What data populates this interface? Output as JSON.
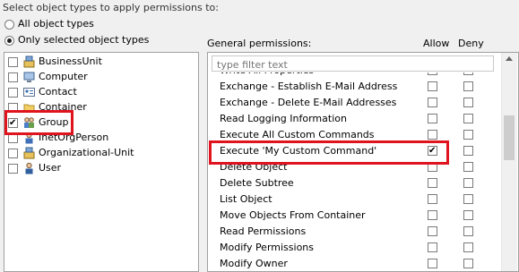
{
  "apply_label": "Select object types to apply permissions to:",
  "radio_all": {
    "label": "All object types",
    "selected": false
  },
  "radio_selected": {
    "label": "Only selected object types",
    "selected": true
  },
  "object_types": [
    {
      "label": "BusinessUnit",
      "icon": "org-unit-icon",
      "checked": false
    },
    {
      "label": "Computer",
      "icon": "computer-icon",
      "checked": false
    },
    {
      "label": "Contact",
      "icon": "contact-card-icon",
      "checked": false
    },
    {
      "label": "Container",
      "icon": "folder-icon",
      "checked": false
    },
    {
      "label": "Group",
      "icon": "group-icon",
      "checked": true
    },
    {
      "label": "InetOrgPerson",
      "icon": "person-icon",
      "checked": false
    },
    {
      "label": "Organizational-Unit",
      "icon": "org-unit-icon",
      "checked": false
    },
    {
      "label": "User",
      "icon": "user-icon",
      "checked": false
    }
  ],
  "general_permissions_label": "General permissions:",
  "allow_label": "Allow",
  "deny_label": "Deny",
  "filter": {
    "placeholder": "type filter text",
    "value": ""
  },
  "permissions": [
    {
      "label": "Write All Properties",
      "allow": false,
      "deny": false
    },
    {
      "label": "Exchange - Establish E-Mail Address",
      "allow": false,
      "deny": false
    },
    {
      "label": "Exchange - Delete E-Mail Addresses",
      "allow": false,
      "deny": false
    },
    {
      "label": "Read Logging Information",
      "allow": false,
      "deny": false
    },
    {
      "label": "Execute All Custom Commands",
      "allow": false,
      "deny": false
    },
    {
      "label": "Execute 'My Custom Command'",
      "allow": true,
      "deny": false
    },
    {
      "label": "Delete Object",
      "allow": false,
      "deny": false
    },
    {
      "label": "Delete Subtree",
      "allow": false,
      "deny": false
    },
    {
      "label": "List Object",
      "allow": false,
      "deny": false
    },
    {
      "label": "Move Objects From Container",
      "allow": false,
      "deny": false
    },
    {
      "label": "Read Permissions",
      "allow": false,
      "deny": false
    },
    {
      "label": "Modify Permissions",
      "allow": false,
      "deny": false
    },
    {
      "label": "Modify Owner",
      "allow": false,
      "deny": false
    }
  ],
  "colors": {
    "highlight_red": "#e0141e",
    "panel_border": "#a0a0a0",
    "background": "#f0f0f0"
  }
}
